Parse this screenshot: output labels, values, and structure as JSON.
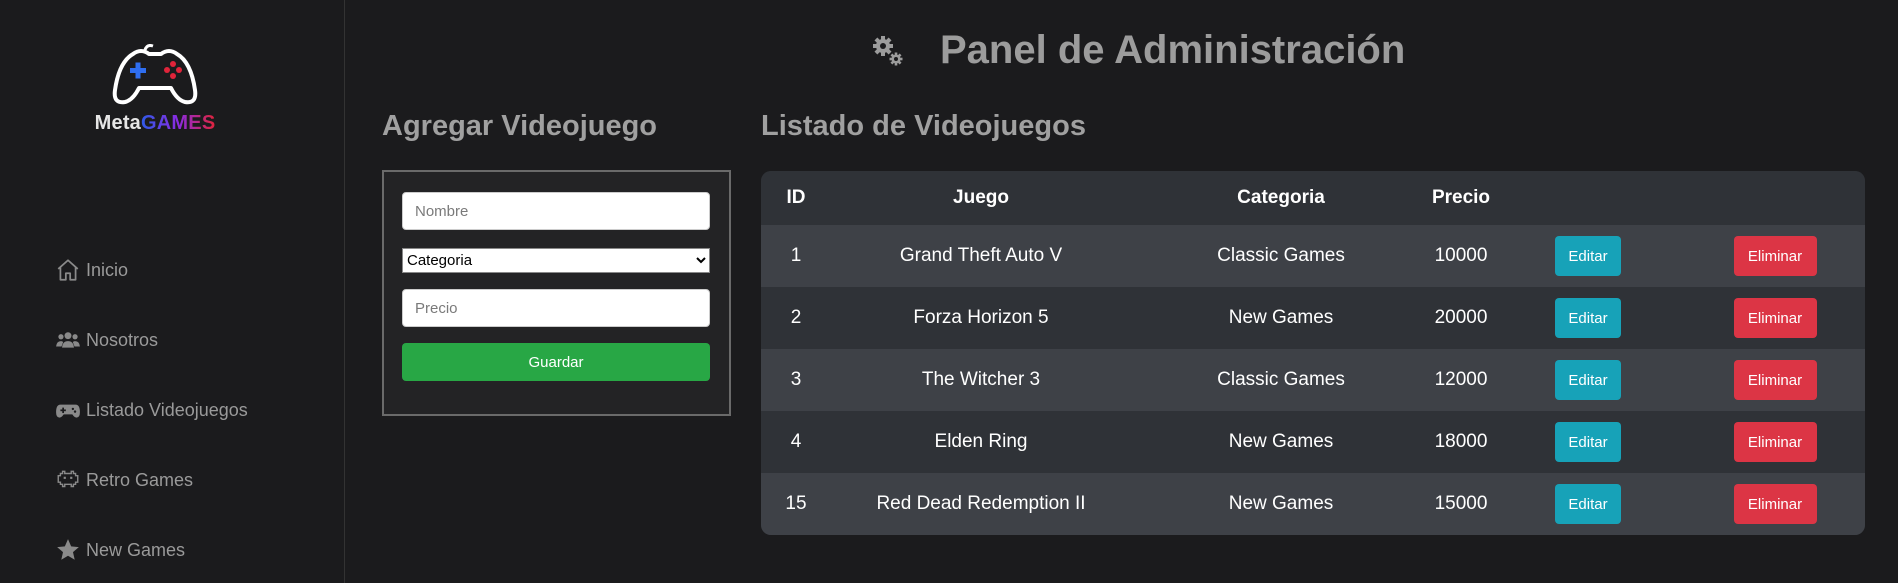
{
  "brand": {
    "meta": "Meta",
    "games": "GAMES"
  },
  "nav": [
    {
      "label": "Inicio",
      "icon": "home-icon"
    },
    {
      "label": "Nosotros",
      "icon": "users-icon"
    },
    {
      "label": "Listado Videojuegos",
      "icon": "gamepad-icon"
    },
    {
      "label": "Retro Games",
      "icon": "space-invader-icon"
    },
    {
      "label": "New Games",
      "icon": "star-icon"
    }
  ],
  "header": {
    "title": "Panel de Administración",
    "icon": "gears-icon"
  },
  "form": {
    "title": "Agregar Videojuego",
    "name_placeholder": "Nombre",
    "category_selected": "Categoria",
    "price_placeholder": "Precio",
    "save_label": "Guardar"
  },
  "list": {
    "title": "Listado de Videojuegos",
    "columns": [
      "ID",
      "Juego",
      "Categoria",
      "Precio",
      "",
      ""
    ],
    "rows": [
      {
        "id": "1",
        "game": "Grand Theft Auto V",
        "category": "Classic Games",
        "price": "10000"
      },
      {
        "id": "2",
        "game": "Forza Horizon 5",
        "category": "New Games",
        "price": "20000"
      },
      {
        "id": "3",
        "game": "The Witcher 3",
        "category": "Classic Games",
        "price": "12000"
      },
      {
        "id": "4",
        "game": "Elden Ring",
        "category": "New Games",
        "price": "18000"
      },
      {
        "id": "15",
        "game": "Red Dead Redemption II",
        "category": "New Games",
        "price": "15000"
      }
    ],
    "edit_label": "Editar",
    "delete_label": "Eliminar"
  },
  "colors": {
    "edit": "#17a2b8",
    "delete": "#dc3545",
    "save": "#28a745"
  }
}
